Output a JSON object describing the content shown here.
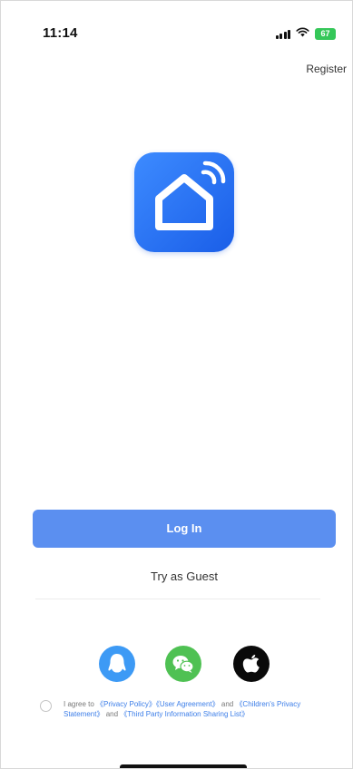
{
  "status_bar": {
    "time": "11:14",
    "battery": "67",
    "icons": [
      "signal-icon",
      "wifi-icon",
      "battery-icon"
    ]
  },
  "header": {
    "register_label": "Register"
  },
  "logo": {
    "icon": "smart-home-icon",
    "colors": {
      "start": "#3d8bff",
      "end": "#1a5ee8"
    }
  },
  "actions": {
    "login_label": "Log In",
    "guest_label": "Try as Guest",
    "login_color": "#5b8ff0"
  },
  "social": [
    {
      "icon": "qq-icon",
      "color": "#3d9af5"
    },
    {
      "icon": "wechat-icon",
      "color": "#4fc153"
    },
    {
      "icon": "apple-icon",
      "color": "#0a0a0a"
    }
  ],
  "agreement": {
    "prefix": "I agree to ",
    "privacy_policy": "《Privacy Policy》",
    "user_agreement": "《User Agreement》",
    "and_1": " and ",
    "children_privacy": "《Children's Privacy Statement》",
    "and_2": " and ",
    "third_party": "《Third Party Information Sharing List》",
    "link_color": "#3b7de8"
  }
}
